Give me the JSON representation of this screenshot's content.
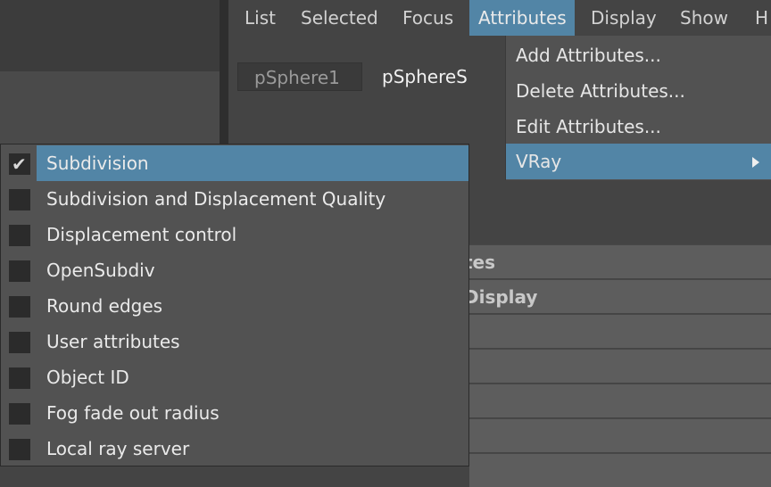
{
  "menubar": {
    "items": [
      "List",
      "Selected",
      "Focus",
      "Attributes",
      "Display",
      "Show",
      "H"
    ],
    "active": "Attributes"
  },
  "tabs": [
    {
      "label": "pSphere1",
      "active": false
    },
    {
      "label": "pSphereS",
      "active": true
    }
  ],
  "attributes_menu": {
    "items": [
      {
        "label": "Add Attributes..."
      },
      {
        "label": "Delete Attributes..."
      },
      {
        "label": "Edit Attributes..."
      },
      {
        "label": "VRay",
        "has_submenu": true,
        "highlighted": true
      }
    ]
  },
  "vray_submenu": {
    "items": [
      {
        "label": "Subdivision",
        "checked": true,
        "highlighted": true
      },
      {
        "label": "Subdivision and Displacement Quality",
        "checked": false
      },
      {
        "label": "Displacement control",
        "checked": false
      },
      {
        "label": "OpenSubdiv",
        "checked": false
      },
      {
        "label": "Round edges",
        "checked": false
      },
      {
        "label": "User attributes",
        "checked": false
      },
      {
        "label": "Object ID",
        "checked": false
      },
      {
        "label": "Fog fade out radius",
        "checked": false
      },
      {
        "label": "Local ray server",
        "checked": false
      }
    ]
  },
  "background_sections": {
    "row1": "tes",
    "row2": "Display"
  },
  "colors": {
    "highlight": "#5285a6",
    "menu_bg": "#525252",
    "app_bg": "#444444"
  }
}
